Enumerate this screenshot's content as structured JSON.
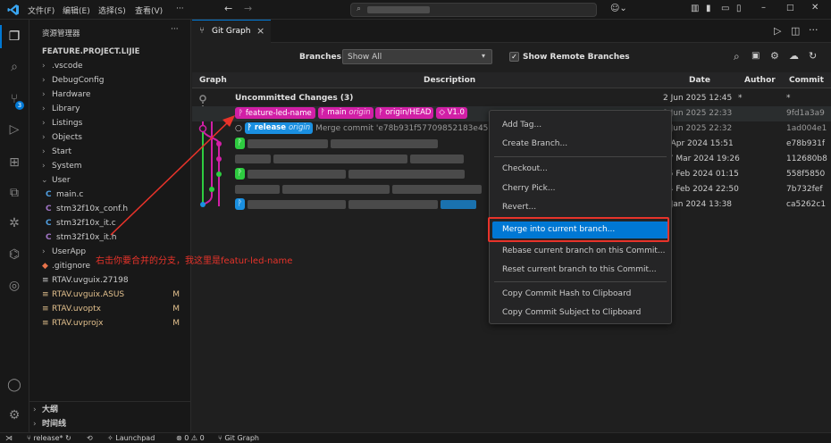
{
  "menu": [
    "文件(F)",
    "编辑(E)",
    "选择(S)",
    "查看(V)",
    "···"
  ],
  "sidebar": {
    "title": "资源管理器",
    "project": "FEATURE.PROJECT.LIJIE",
    "items": [
      {
        "label": ".vscode"
      },
      {
        "label": "DebugConfig"
      },
      {
        "label": "Hardware"
      },
      {
        "label": "Library"
      },
      {
        "label": "Listings"
      },
      {
        "label": "Objects"
      },
      {
        "label": "Start"
      },
      {
        "label": "System"
      },
      {
        "label": "User"
      },
      {
        "label": "main.c"
      },
      {
        "label": "stm32f10x_conf.h"
      },
      {
        "label": "stm32f10x_it.c"
      },
      {
        "label": "stm32f10x_it.h"
      },
      {
        "label": "UserApp"
      },
      {
        "label": ".gitignore"
      },
      {
        "label": "RTAV.uvguix.27198"
      },
      {
        "label": "RTAV.uvguix.ASUS",
        "status": "M"
      },
      {
        "label": "RTAV.uvoptx",
        "status": "M"
      },
      {
        "label": "RTAV.uvprojx",
        "status": "M"
      }
    ],
    "outline": "大纲",
    "timeline": "时间线"
  },
  "activity_badge": "3",
  "tab": {
    "label": "Git Graph",
    "close": "×"
  },
  "toolbar": {
    "branches_label": "Branches:",
    "branches_value": "Show All",
    "show_remote_label": "Show Remote Branches"
  },
  "columns": {
    "graph": "Graph",
    "description": "Description",
    "date": "Date",
    "author": "Author",
    "commit": "Commit"
  },
  "commits": [
    {
      "description": "Uncommitted Changes (3)",
      "date": "2 Jun 2025 12:45",
      "author": "*",
      "commit": "*"
    },
    {
      "refs": [
        "feature-led-name",
        "main",
        "origin",
        "origin/HEAD",
        "V1.0"
      ],
      "date": "1 Jun 2025 22:33",
      "commit": "9fd1a3a9"
    },
    {
      "refs": [
        "release",
        "origin"
      ],
      "description": "Merge commit 'e78b931f57709852183e459ad",
      "date": "1 Jun 2025 22:32",
      "commit": "1ad004e1"
    },
    {
      "date": "2 Apr 2024 15:51",
      "commit": "e78b931f"
    },
    {
      "date": "27 Mar 2024 19:26",
      "commit": "112680b8"
    },
    {
      "date": "25 Feb 2024 01:15",
      "commit": "558f5850"
    },
    {
      "date": "24 Feb 2024 22:50",
      "commit": "7b732fef"
    },
    {
      "date": "5 Jan 2024 13:38",
      "commit": "ca5262c1"
    }
  ],
  "context_menu": [
    "Add Tag...",
    "Create Branch...",
    "Checkout...",
    "Cherry Pick...",
    "Revert...",
    "Merge into current branch...",
    "Rebase current branch on this Commit...",
    "Reset current branch to this Commit...",
    "Copy Commit Hash to Clipboard",
    "Copy Commit Subject to Clipboard"
  ],
  "annotation": "右击你要合并的分支，我这里是featur-led-name",
  "statusbar": {
    "branch": "release*",
    "launchpad": "Launchpad",
    "problems": "⊗ 0 ⚠ 0",
    "gitgraph": "Git Graph"
  },
  "colors": {
    "accent": "#0078d4",
    "annotation": "#e8332a",
    "graph_magenta": "#d11fa6",
    "graph_green": "#2ecc40",
    "graph_blue": "#1a8fe0"
  }
}
